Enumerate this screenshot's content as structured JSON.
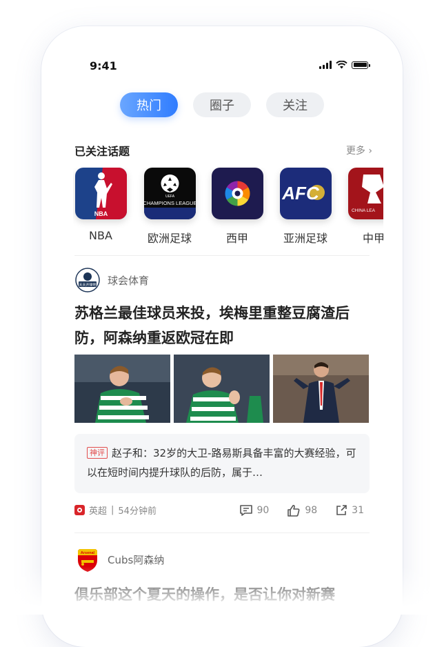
{
  "status": {
    "time": "9:41"
  },
  "tabs": [
    {
      "label": "热门"
    },
    {
      "label": "圈子"
    },
    {
      "label": "关注"
    }
  ],
  "topics_section": {
    "title": "已关注话题",
    "more": "更多 ›",
    "items": [
      {
        "label": "NBA",
        "logo_text": "NBA"
      },
      {
        "label": "欧洲足球",
        "logo_text": "CHAMPIONS LEAGUE",
        "logo_small": "UEFA"
      },
      {
        "label": "西甲",
        "logo_text": ""
      },
      {
        "label": "亚洲足球",
        "logo_text": "AFC"
      },
      {
        "label": "中甲",
        "logo_text": "CHINA LEA"
      }
    ]
  },
  "article1": {
    "source": "球会体育",
    "avatar_text": "天天开球吧",
    "title": "苏格兰最佳球员来投，埃梅里重整豆腐渣后防，阿森纳重返欧冠在即",
    "comment_badge": "神评",
    "comment": "赵子和：32岁的大卫-路易斯具备丰富的大赛经验，可以在短时间内提升球队的后防，属于…",
    "league": "英超",
    "time": "54分钟前",
    "comments": "90",
    "likes": "98",
    "shares": "31"
  },
  "article2": {
    "source": "Cubs阿森纳",
    "avatar_text": "Arsenal",
    "title": "俱乐部这个夏天的操作，是否让你对新赛"
  },
  "colors": {
    "accent": "#2f7cff",
    "badge": "#e24c4c"
  }
}
